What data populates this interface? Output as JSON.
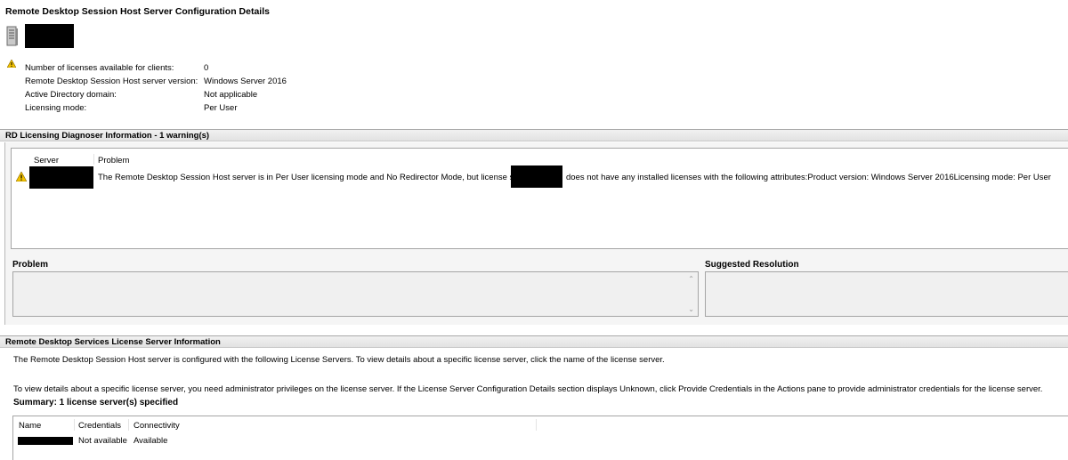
{
  "title": "Remote Desktop Session Host Server Configuration Details",
  "icons": {
    "server": "server-icon",
    "warning": "warning-icon"
  },
  "server_info": {
    "rows": [
      {
        "label": "Number of licenses available for clients:",
        "value": "0"
      },
      {
        "label": "Remote Desktop Session Host server version:",
        "value": "Windows Server 2016"
      },
      {
        "label": "Active Directory domain:",
        "value": "Not applicable"
      },
      {
        "label": "Licensing mode:",
        "value": "Per User"
      }
    ]
  },
  "diagnoser": {
    "header": "RD Licensing Diagnoser Information - 1 warning(s)",
    "columns": {
      "server": "Server",
      "problem": "Problem"
    },
    "warning_text_before": "The Remote Desktop Session Host server is in Per User licensing mode and No Redirector Mode, but license server",
    "warning_text_after": "does not have any installed licenses with the following attributes:Product version: Windows Server 2016Licensing mode: Per User",
    "problem_label": "Problem",
    "resolution_label": "Suggested Resolution"
  },
  "license_server": {
    "header": "Remote Desktop Services License Server Information",
    "description1": "The Remote Desktop Session Host server is configured with the following License Servers. To view details about a specific license server, click the name of the license server.",
    "description2": "To view details about a specific license server, you need administrator privileges on the license server. If the License Server Configuration Details section displays Unknown, click Provide Credentials in the Actions pane to provide administrator credentials for the license server.",
    "summary": "Summary: 1 license server(s) specified",
    "columns": {
      "name": "Name",
      "credentials": "Credentials",
      "connectivity": "Connectivity"
    },
    "row": {
      "credentials": "Not available",
      "connectivity": "Available"
    }
  },
  "colors": {
    "warning_yellow": "#f2c200",
    "section_header_bg": "#e8e8e8"
  }
}
